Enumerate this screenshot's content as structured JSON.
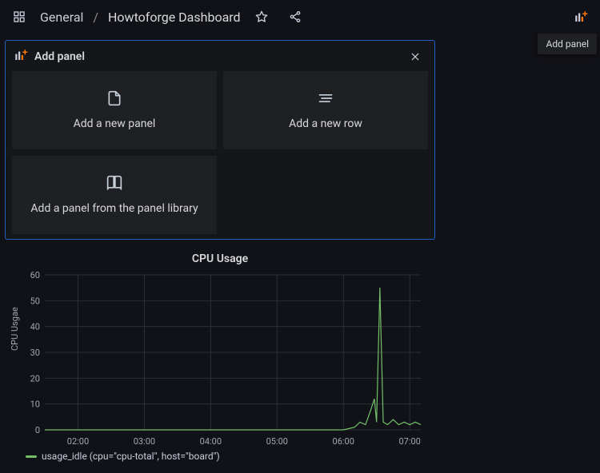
{
  "header": {
    "breadcrumb_root": "General",
    "breadcrumb_sep": "/",
    "breadcrumb_current": "Howtoforge Dashboard"
  },
  "toolbar": {
    "add_panel_tooltip": "Add panel"
  },
  "drawer": {
    "title": "Add panel",
    "cards": {
      "new_panel": "Add a new panel",
      "new_row": "Add a new row",
      "from_library": "Add a panel from the panel library"
    }
  },
  "panel": {
    "title": "CPU Usage",
    "legend_label": "usage_idle (cpu=\"cpu-total\", host=\"board\")"
  },
  "chart_data": {
    "type": "line",
    "title": "CPU Usage",
    "xlabel": "",
    "ylabel": "CPU Usgae",
    "ylim": [
      0,
      60
    ],
    "x_ticks": [
      "02:00",
      "03:00",
      "04:00",
      "05:00",
      "06:00",
      "07:00"
    ],
    "y_ticks": [
      0,
      10,
      20,
      30,
      40,
      50,
      60
    ],
    "series": [
      {
        "name": "usage_idle (cpu=\"cpu-total\", host=\"board\")",
        "color": "#73bf69",
        "x": [
          "01:30",
          "02:00",
          "02:30",
          "03:00",
          "03:30",
          "04:00",
          "04:30",
          "05:00",
          "05:30",
          "06:00",
          "06:10",
          "06:15",
          "06:20",
          "06:25",
          "06:28",
          "06:30",
          "06:33",
          "06:36",
          "06:40",
          "06:45",
          "06:50",
          "06:55",
          "07:00",
          "07:05",
          "07:10"
        ],
        "y": [
          0,
          0,
          0,
          0,
          0,
          0,
          0,
          0,
          0,
          0,
          1,
          3,
          2,
          8,
          12,
          3,
          55,
          3,
          2,
          4,
          2,
          3,
          2,
          3,
          2
        ]
      }
    ]
  }
}
